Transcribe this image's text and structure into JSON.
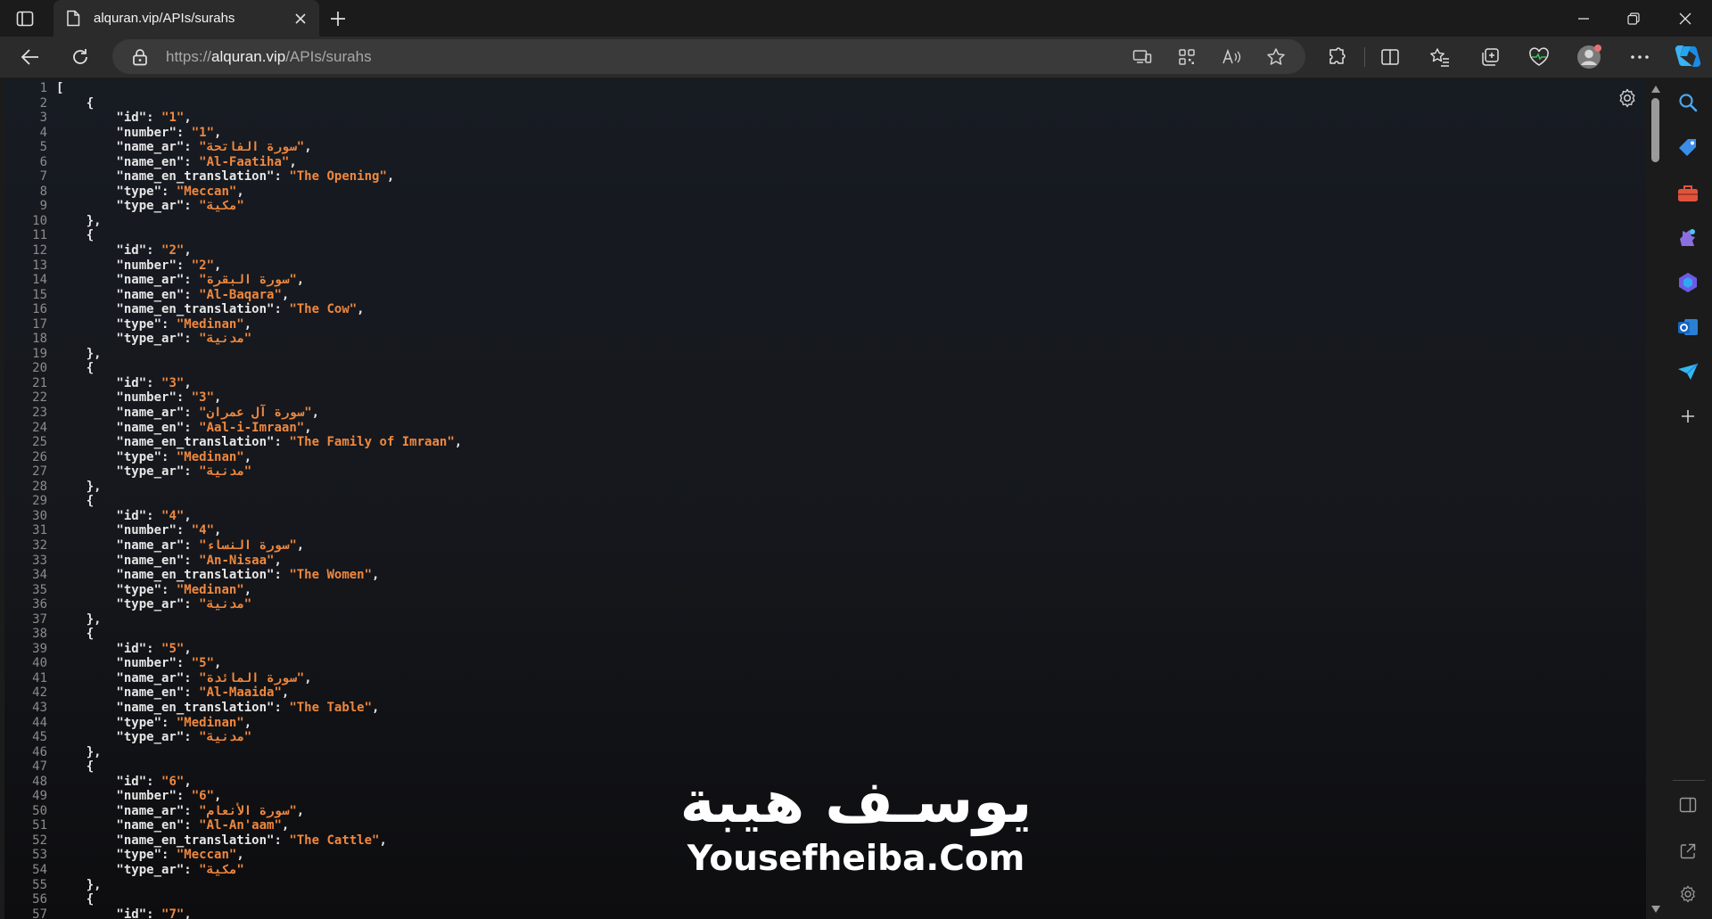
{
  "tab": {
    "title": "alquran.vip/APIs/surahs"
  },
  "address": {
    "scheme": "https://",
    "host": "alquran.vip",
    "path": "/APIs/surahs"
  },
  "watermark": {
    "arabic": "يوسـف هيبة",
    "english": "Yousefheiba.Com"
  },
  "colors": {
    "json_string": "#f0883e",
    "json_key": "#e6e6e6",
    "line_number": "#8b8b8b"
  },
  "icons": {
    "tabstrip": [
      "tab-actions-icon",
      "page-icon",
      "close-icon",
      "plus-icon",
      "minimize-icon",
      "restore-icon",
      "window-close-icon"
    ],
    "toolbar": [
      "back-arrow-icon",
      "refresh-icon",
      "lock-icon",
      "app-available-icon",
      "qr-code-icon",
      "read-aloud-icon",
      "favorite-star-icon",
      "extensions-icon",
      "split-screen-icon",
      "favorites-icon",
      "collections-icon",
      "browser-essentials-icon",
      "profile-avatar-icon",
      "more-icon",
      "copilot-icon"
    ],
    "sidebar": [
      "search-icon",
      "shopping-tag-icon",
      "tools-icon",
      "games-icon",
      "microsoft-365-icon",
      "outlook-icon",
      "drop-icon",
      "add-icon",
      "hide-sidebar-icon",
      "open-external-icon",
      "settings-icon"
    ]
  },
  "lines": [
    {
      "n": "1",
      "t": "["
    },
    {
      "n": "2",
      "t": "    {"
    },
    {
      "n": "3",
      "k": "id",
      "v": "1",
      "c": ","
    },
    {
      "n": "4",
      "k": "number",
      "v": "1",
      "c": ","
    },
    {
      "n": "5",
      "k": "name_ar",
      "v": "سورة الفاتحة",
      "c": ","
    },
    {
      "n": "6",
      "k": "name_en",
      "v": "Al-Faatiha",
      "c": ","
    },
    {
      "n": "7",
      "k": "name_en_translation",
      "v": "The Opening",
      "c": ","
    },
    {
      "n": "8",
      "k": "type",
      "v": "Meccan",
      "c": ","
    },
    {
      "n": "9",
      "k": "type_ar",
      "v": "مكية",
      "c": ""
    },
    {
      "n": "10",
      "t": "    },"
    },
    {
      "n": "11",
      "t": "    {"
    },
    {
      "n": "12",
      "k": "id",
      "v": "2",
      "c": ","
    },
    {
      "n": "13",
      "k": "number",
      "v": "2",
      "c": ","
    },
    {
      "n": "14",
      "k": "name_ar",
      "v": "سورة البقرة",
      "c": ","
    },
    {
      "n": "15",
      "k": "name_en",
      "v": "Al-Baqara",
      "c": ","
    },
    {
      "n": "16",
      "k": "name_en_translation",
      "v": "The Cow",
      "c": ","
    },
    {
      "n": "17",
      "k": "type",
      "v": "Medinan",
      "c": ","
    },
    {
      "n": "18",
      "k": "type_ar",
      "v": "مدنية",
      "c": ""
    },
    {
      "n": "19",
      "t": "    },"
    },
    {
      "n": "20",
      "t": "    {"
    },
    {
      "n": "21",
      "k": "id",
      "v": "3",
      "c": ","
    },
    {
      "n": "22",
      "k": "number",
      "v": "3",
      "c": ","
    },
    {
      "n": "23",
      "k": "name_ar",
      "v": "سورة آل عمران",
      "c": ","
    },
    {
      "n": "24",
      "k": "name_en",
      "v": "Aal-i-Imraan",
      "c": ","
    },
    {
      "n": "25",
      "k": "name_en_translation",
      "v": "The Family of Imraan",
      "c": ","
    },
    {
      "n": "26",
      "k": "type",
      "v": "Medinan",
      "c": ","
    },
    {
      "n": "27",
      "k": "type_ar",
      "v": "مدنية",
      "c": ""
    },
    {
      "n": "28",
      "t": "    },"
    },
    {
      "n": "29",
      "t": "    {"
    },
    {
      "n": "30",
      "k": "id",
      "v": "4",
      "c": ","
    },
    {
      "n": "31",
      "k": "number",
      "v": "4",
      "c": ","
    },
    {
      "n": "32",
      "k": "name_ar",
      "v": "سورة النساء",
      "c": ","
    },
    {
      "n": "33",
      "k": "name_en",
      "v": "An-Nisaa",
      "c": ","
    },
    {
      "n": "34",
      "k": "name_en_translation",
      "v": "The Women",
      "c": ","
    },
    {
      "n": "35",
      "k": "type",
      "v": "Medinan",
      "c": ","
    },
    {
      "n": "36",
      "k": "type_ar",
      "v": "مدنية",
      "c": ""
    },
    {
      "n": "37",
      "t": "    },"
    },
    {
      "n": "38",
      "t": "    {"
    },
    {
      "n": "39",
      "k": "id",
      "v": "5",
      "c": ","
    },
    {
      "n": "40",
      "k": "number",
      "v": "5",
      "c": ","
    },
    {
      "n": "41",
      "k": "name_ar",
      "v": "سورة المائدة",
      "c": ","
    },
    {
      "n": "42",
      "k": "name_en",
      "v": "Al-Maaida",
      "c": ","
    },
    {
      "n": "43",
      "k": "name_en_translation",
      "v": "The Table",
      "c": ","
    },
    {
      "n": "44",
      "k": "type",
      "v": "Medinan",
      "c": ","
    },
    {
      "n": "45",
      "k": "type_ar",
      "v": "مدنية",
      "c": ""
    },
    {
      "n": "46",
      "t": "    },"
    },
    {
      "n": "47",
      "t": "    {"
    },
    {
      "n": "48",
      "k": "id",
      "v": "6",
      "c": ","
    },
    {
      "n": "49",
      "k": "number",
      "v": "6",
      "c": ","
    },
    {
      "n": "50",
      "k": "name_ar",
      "v": "سورة الأنعام",
      "c": ","
    },
    {
      "n": "51",
      "k": "name_en",
      "v": "Al-An'aam",
      "c": ","
    },
    {
      "n": "52",
      "k": "name_en_translation",
      "v": "The Cattle",
      "c": ","
    },
    {
      "n": "53",
      "k": "type",
      "v": "Meccan",
      "c": ","
    },
    {
      "n": "54",
      "k": "type_ar",
      "v": "مكية",
      "c": ""
    },
    {
      "n": "55",
      "t": "    },"
    },
    {
      "n": "56",
      "t": "    {"
    },
    {
      "n": "57",
      "k": "id",
      "v": "7",
      "c": ","
    }
  ]
}
